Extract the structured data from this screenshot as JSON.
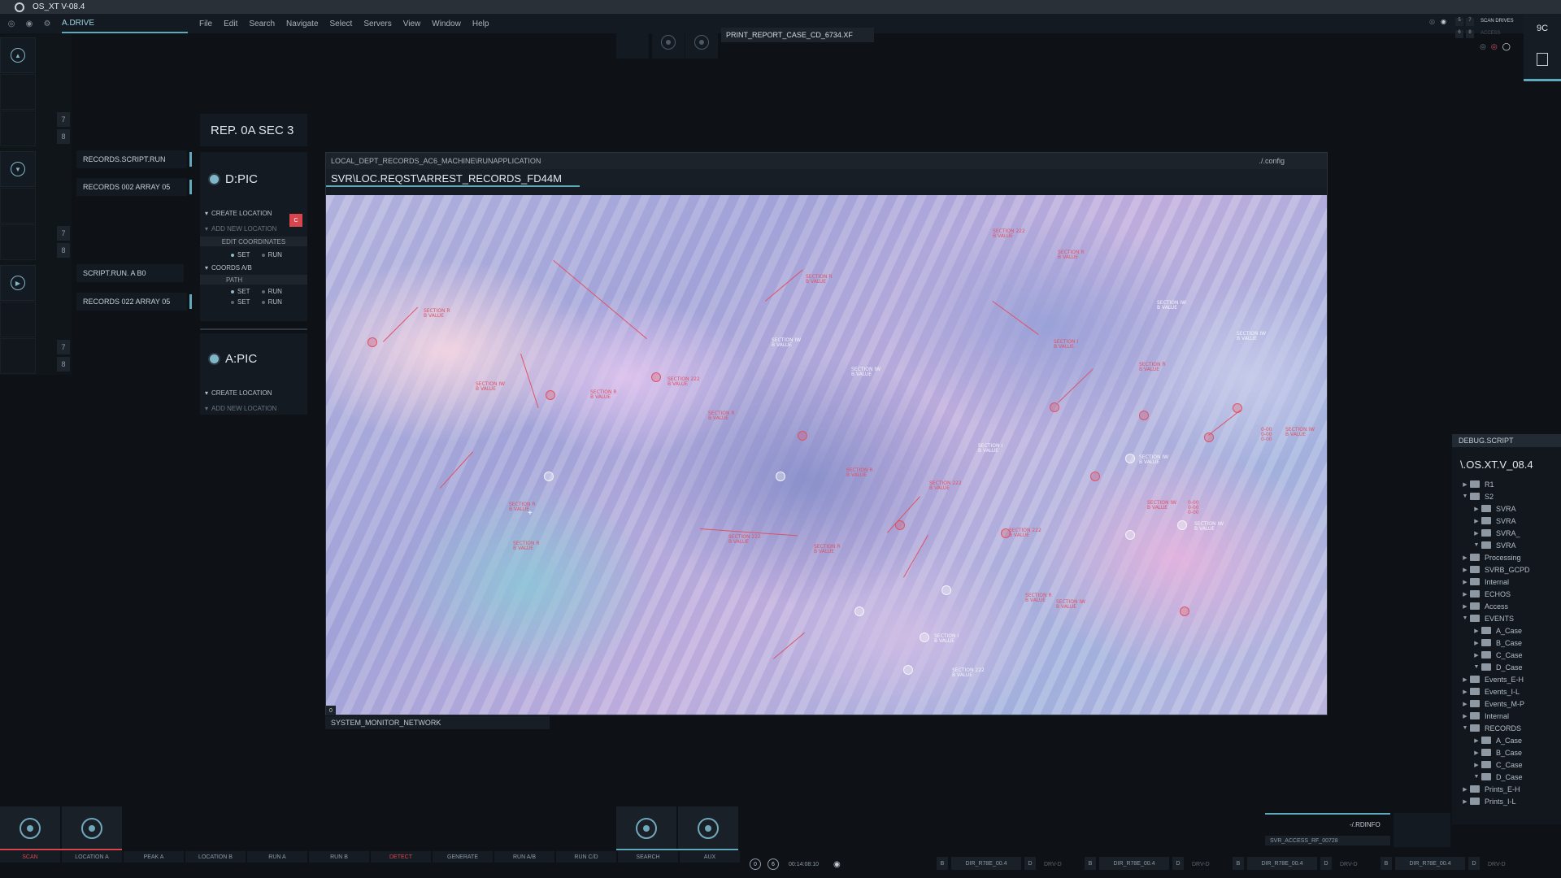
{
  "window": {
    "title": "OS_XT V-08.4"
  },
  "menubar": {
    "drive": "A.DRIVE",
    "items": [
      "File",
      "Edit",
      "Search",
      "Navigate",
      "Select",
      "Servers",
      "View",
      "Window",
      "Help"
    ]
  },
  "toolbar": {
    "print_report": "PRINT_REPORT_CASE_CD_6734.XF"
  },
  "sysctrl": {
    "scan_drives": "SCAN DRIVES",
    "access": "ACCESS",
    "counter": "9C",
    "mini": [
      "5",
      "7",
      "6",
      "8"
    ]
  },
  "rail": {
    "numbers": [
      "7",
      "8",
      "7",
      "8",
      "7",
      "8"
    ]
  },
  "scripts": [
    "RECORDS.SCRIPT.RUN",
    "RECORDS 002 ARRAY 05",
    "SCRIPT.RUN. A B0",
    "RECORDS 022 ARRAY 05"
  ],
  "props": {
    "header": "REP. 0A SEC 3",
    "dpic": {
      "label": "D:PIC",
      "create_location": "CREATE LOCATION",
      "create_badge": "C",
      "add_new_location": "ADD NEW LOCATION",
      "edit_coordinates": "EDIT COORDINATES",
      "set": "SET",
      "run": "RUN",
      "coords": "COORDS A/B",
      "path": "PATH"
    },
    "apic": {
      "label": "A:PIC",
      "create_location": "CREATE LOCATION",
      "add_new_location": "ADD NEW LOCATION"
    }
  },
  "viewport": {
    "path": "LOCAL_DEPT_RECORDS_AC6_MACHINE\\RUNAPPLICATION",
    "config": "./.config",
    "title": "SVR\\LOC.REQST\\ARREST_RECORDS_FD44M",
    "corner": "0",
    "footer": "SYSTEM_MONITOR_NETWORK",
    "annotations": {
      "section_222": "SECTION 222",
      "section_r": "SECTION R",
      "section_iw": "SECTION IW",
      "section_i": "SECTION I",
      "b_value": "B VALUE",
      "value_1": "0-00",
      "value_2": "0-00",
      "value_3": "0-00"
    }
  },
  "tree": {
    "header": "DEBUG.SCRIPT",
    "root": "\\.OS.XT.V_08.4",
    "items": [
      {
        "label": "R1",
        "level": 0,
        "open": false
      },
      {
        "label": "S2",
        "level": 0,
        "open": true
      },
      {
        "label": "SVRA",
        "level": 1,
        "open": false
      },
      {
        "label": "SVRA",
        "level": 1,
        "open": false
      },
      {
        "label": "SVRA_",
        "level": 1,
        "open": false
      },
      {
        "label": "SVRA",
        "level": 1,
        "open": true
      },
      {
        "label": "Processing",
        "level": 0,
        "open": false
      },
      {
        "label": "SVRB_GCPD",
        "level": 0,
        "open": false
      },
      {
        "label": "Internal",
        "level": 0,
        "open": false
      },
      {
        "label": "ECHOS",
        "level": 0,
        "open": false
      },
      {
        "label": "Access",
        "level": 0,
        "open": false
      },
      {
        "label": "EVENTS",
        "level": 0,
        "open": true
      },
      {
        "label": "A_Case",
        "level": 1,
        "open": false
      },
      {
        "label": "B_Case",
        "level": 1,
        "open": false
      },
      {
        "label": "C_Case",
        "level": 1,
        "open": false
      },
      {
        "label": "D_Case",
        "level": 1,
        "open": true
      },
      {
        "label": "Events_E-H",
        "level": 0,
        "open": false
      },
      {
        "label": "Events_I-L",
        "level": 0,
        "open": false
      },
      {
        "label": "Events_M-P",
        "level": 0,
        "open": false
      },
      {
        "label": "Internal",
        "level": 0,
        "open": false
      },
      {
        "label": "RECORDS",
        "level": 0,
        "open": true
      },
      {
        "label": "A_Case",
        "level": 1,
        "open": false
      },
      {
        "label": "B_Case",
        "level": 1,
        "open": false
      },
      {
        "label": "C_Case",
        "level": 1,
        "open": false
      },
      {
        "label": "D_Case",
        "level": 1,
        "open": true
      },
      {
        "label": "Prints_E-H",
        "level": 0,
        "open": false
      },
      {
        "label": "Prints_I-L",
        "level": 0,
        "open": false
      }
    ]
  },
  "rdinfo": {
    "label": "-/.RDINFO",
    "access": "SVR_ACCESS_RF_00728"
  },
  "bottom": {
    "labels": [
      "SCAN",
      "LOCATION A",
      "PEAK A",
      "LOCATION B",
      "RUN A",
      "RUN B",
      "DETECT",
      "GENERATE",
      "RUN A/B",
      "RUN C/D",
      "SEARCH",
      "AUX"
    ],
    "status": {
      "a": "0",
      "b": "6",
      "time": "00:14:08:10"
    },
    "drives": [
      {
        "b": "B",
        "name": "DIR_R78E_00.4",
        "d": "D",
        "drv": "DRV-D"
      },
      {
        "b": "B",
        "name": "DIR_R78E_00.4",
        "d": "D",
        "drv": "DRV-D"
      },
      {
        "b": "B",
        "name": "DIR_R78E_00.4",
        "d": "D",
        "drv": "DRV-D"
      },
      {
        "b": "B",
        "name": "DIR_R78E_00.4",
        "d": "D",
        "drv": "DRV-D"
      }
    ]
  },
  "colors": {
    "accent": "#5fa9bd",
    "alert": "#e05263",
    "bg": "#0e1217"
  }
}
